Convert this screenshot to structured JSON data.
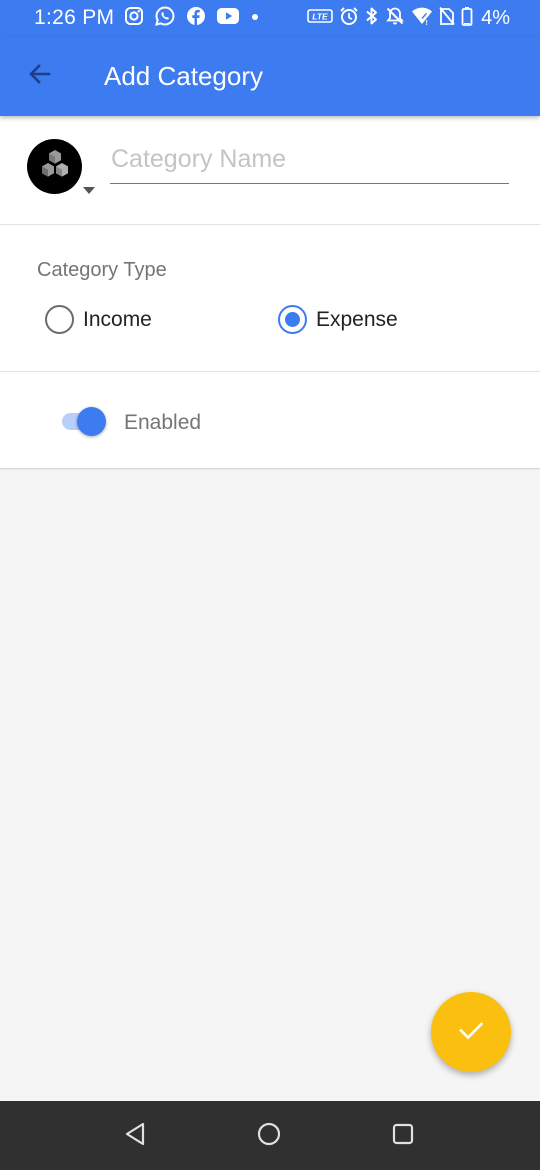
{
  "status_bar": {
    "time": "1:26 PM",
    "battery_percent": "4%",
    "left_icons": [
      "instagram-icon",
      "whatsapp-icon",
      "facebook-icon",
      "youtube-icon",
      "dot-icon"
    ],
    "right_icons": [
      "volte-icon",
      "alarm-icon",
      "bluetooth-icon",
      "mute-icon",
      "wifi-icon",
      "no-sim-icon",
      "battery-icon"
    ]
  },
  "app_bar": {
    "title": "Add Category",
    "back_icon": "arrow-left-icon",
    "color": "#3d7bf0"
  },
  "name_row": {
    "icon": "cubes-icon",
    "dropdown_icon": "caret-down-icon",
    "placeholder": "Category Name",
    "value": ""
  },
  "category_type": {
    "title": "Category Type",
    "options": [
      {
        "label": "Income",
        "selected": false
      },
      {
        "label": "Expense",
        "selected": true
      }
    ]
  },
  "enabled": {
    "label": "Enabled",
    "on": true
  },
  "fab": {
    "icon": "check-icon",
    "color": "#fbbf10"
  },
  "nav_bar": {
    "icons": [
      "nav-back-icon",
      "nav-home-icon",
      "nav-recent-icon"
    ]
  }
}
